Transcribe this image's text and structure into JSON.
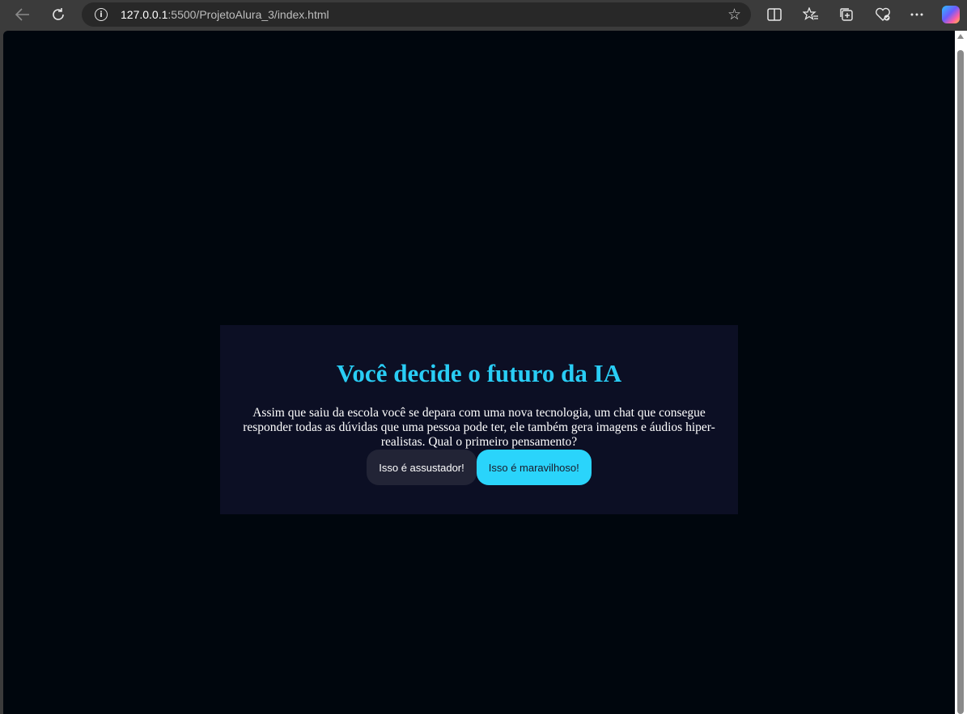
{
  "browser": {
    "url_host": "127.0.0.1",
    "url_path": ":5500/ProjetoAlura_3/index.html",
    "info_icon": "i"
  },
  "page": {
    "title": "Você decide o futuro da IA",
    "question": "Assim que saiu da escola você se depara com uma nova tecnologia, um chat que consegue responder todas as dúvidas que uma pessoa pode ter, ele também gera imagens e áudios hiper-realistas. Qual o primeiro pensamento?",
    "answers": [
      "Isso é assustador!",
      "Isso é maravilhoso!"
    ]
  },
  "colors": {
    "page_background": "#00060d",
    "card_background": "#0c0f24",
    "title_color": "#29cdf5",
    "answer_dark": "#222436",
    "answer_light": "#2ad4fb"
  }
}
